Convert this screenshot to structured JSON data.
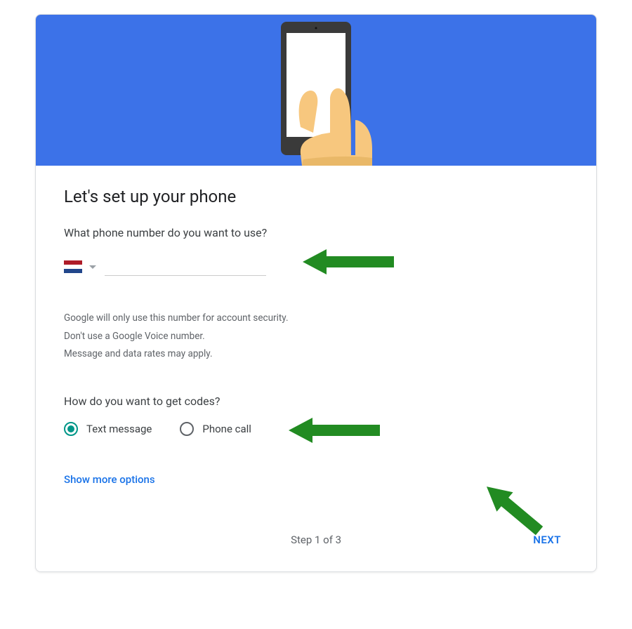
{
  "header": {
    "title": "Let's set up your phone"
  },
  "phone_section": {
    "question": "What phone number do you want to use?",
    "country_flag": "netherlands-flag",
    "phone_value": ""
  },
  "info_lines": [
    "Google will only use this number for account security.",
    "Don't use a Google Voice number.",
    "Message and data rates may apply."
  ],
  "codes_section": {
    "question": "How do you want to get codes?",
    "options": [
      {
        "label": "Text message",
        "selected": true
      },
      {
        "label": "Phone call",
        "selected": false
      }
    ]
  },
  "more_options": {
    "label": "Show more options"
  },
  "footer": {
    "step": "Step 1 of 3",
    "next": "NEXT"
  },
  "colors": {
    "hero_bg": "#3c72e8",
    "accent_link": "#1a73e8",
    "radio_selected": "#009688",
    "annotation_arrow": "#228B22"
  }
}
